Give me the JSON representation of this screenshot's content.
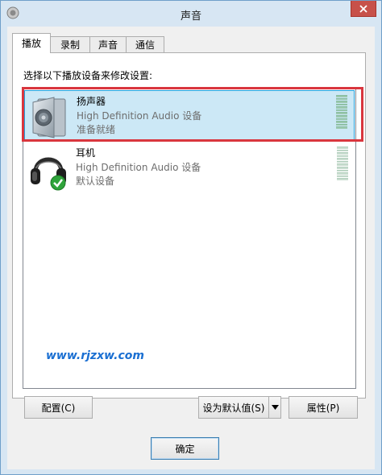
{
  "window": {
    "title": "声音"
  },
  "tabs": [
    {
      "label": "播放",
      "active": true
    },
    {
      "label": "录制",
      "active": false
    },
    {
      "label": "声音",
      "active": false
    },
    {
      "label": "通信",
      "active": false
    }
  ],
  "panel": {
    "instruction": "选择以下播放设备来修改设置:",
    "devices": [
      {
        "name": "扬声器",
        "driver": "High Definition Audio 设备",
        "status": "准备就绪",
        "icon": "speaker-icon",
        "selected": true
      },
      {
        "name": "耳机",
        "driver": "High Definition Audio 设备",
        "status": "默认设备",
        "icon": "headphones-icon",
        "default_badge": "checkmark-icon",
        "selected": false
      }
    ],
    "watermark": "www.rjzxw.com"
  },
  "buttons": {
    "configure": "配置(C)",
    "set_default": "设为默认值(S)",
    "properties": "属性(P)",
    "ok": "确定"
  },
  "colors": {
    "selection_bg": "#cce8f6",
    "highlight_border": "#d9363e",
    "close_button": "#c7514a"
  }
}
